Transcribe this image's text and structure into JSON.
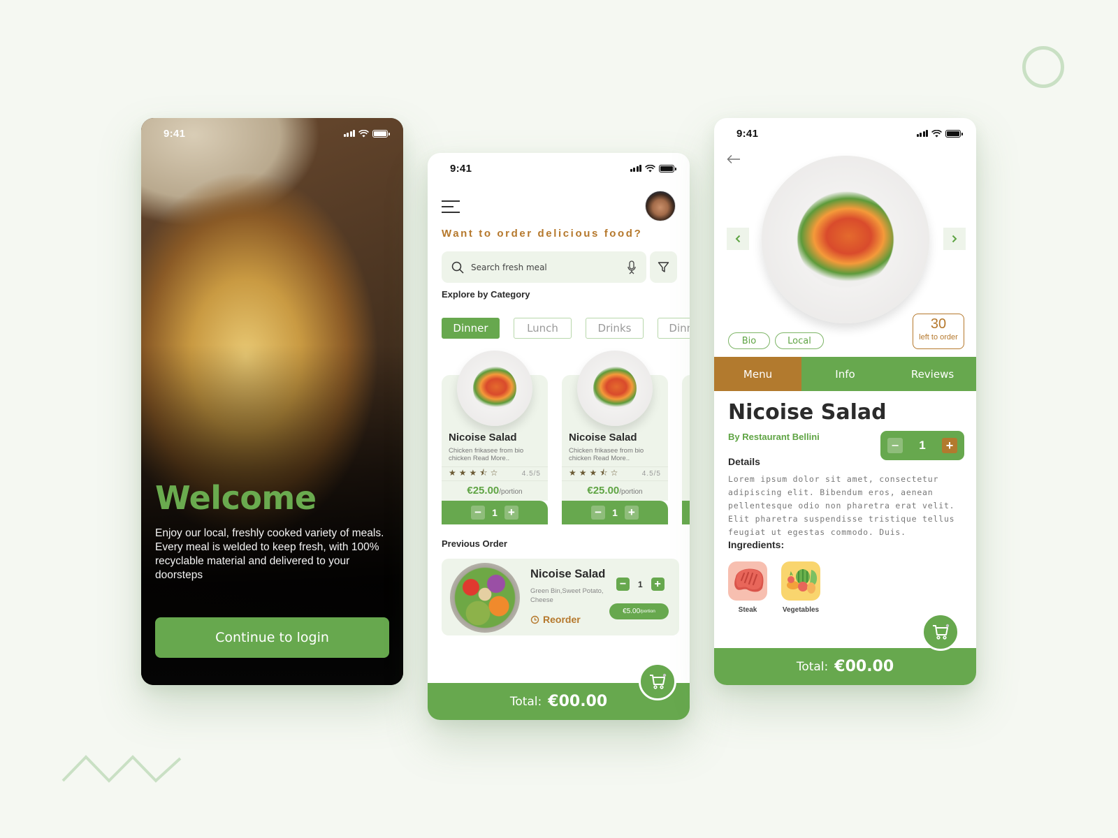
{
  "status_bar": {
    "time": "9:41"
  },
  "welcome_screen": {
    "title": "Welcome",
    "intro": "Enjoy our local, freshly cooked variety of meals. Every meal is welded to keep fresh, with 100% recyclable material and delivered to your doorsteps",
    "login_button": "Continue to login"
  },
  "home_screen": {
    "tagline": "Want to order delicious food?",
    "search": {
      "placeholder": "Search fresh meal",
      "value": ""
    },
    "explore_title": "Explore by Category",
    "categories": [
      {
        "label": "Dinner",
        "active": true
      },
      {
        "label": "Lunch",
        "active": false
      },
      {
        "label": "Drinks",
        "active": false
      },
      {
        "label": "Dinner",
        "active": false
      }
    ],
    "meals": [
      {
        "name": "Nicoise Salad",
        "description": "Chicken frikasee from bio chicken Read More..",
        "stars": "★★★⯪☆",
        "rating": "4.5/5",
        "price": "€25.00",
        "unit": "/portion",
        "quantity": "1"
      },
      {
        "name": "Nicoise Salad",
        "description": "Chicken frikasee from bio chicken Read More..",
        "stars": "★★★⯪☆",
        "rating": "4.5/5",
        "price": "€25.00",
        "unit": "/portion",
        "quantity": "1"
      }
    ],
    "previous_order_title": "Previous Order",
    "previous_order": {
      "name": "Nicoise Salad",
      "description": "Green Bin,Sweet Potato, Cheese",
      "reorder_label": "Reorder",
      "quantity": "1",
      "price": "€5.00",
      "unit": "/portion"
    },
    "total_label": "Total:",
    "total_amount": "€00.00"
  },
  "detail_screen": {
    "tags": [
      "Bio",
      "Local"
    ],
    "stock_count": "30",
    "stock_label": "left to order",
    "tabs": [
      {
        "label": "Menu",
        "active": true
      },
      {
        "label": "Info",
        "active": false
      },
      {
        "label": "Reviews",
        "active": false
      }
    ],
    "dish_name": "Nicoise Salad",
    "restaurant": "By Restaurant Bellini",
    "quantity": "1",
    "details_title": "Details",
    "details_text": "Lorem ipsum dolor sit amet, consectetur adipiscing elit. Bibendum eros, aenean pellentesque odio non pharetra erat velit. Elit pharetra suspendisse tristique tellus feugiat ut egestas commodo. Duis.",
    "ingredients_title": "Ingredients:",
    "ingredients": [
      {
        "label": "Steak",
        "icon": "steak-icon",
        "color": "#f7bfb0"
      },
      {
        "label": "Vegetables",
        "icon": "vegetables-icon",
        "color": "#f9d56e"
      }
    ],
    "total_label": "Total:",
    "total_amount": "€00.00"
  },
  "colors": {
    "primary_green": "#67a84e",
    "accent_brown": "#b27a2e",
    "light_green_bg": "#eef4ea",
    "page_bg": "#f5f8f2"
  }
}
